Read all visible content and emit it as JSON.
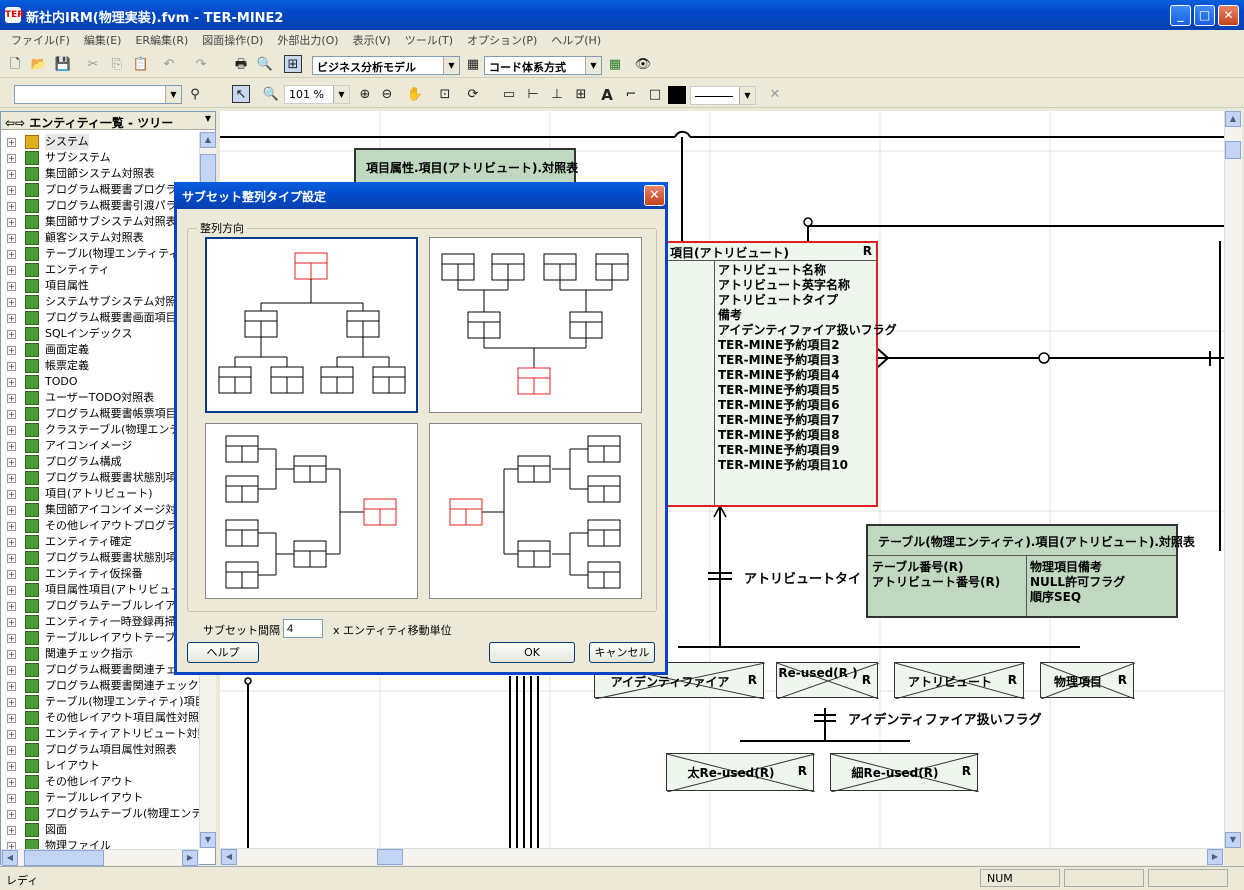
{
  "window": {
    "title": "新社内IRM(物理実装).fvm - TER-MINE2",
    "icon_text": "TER"
  },
  "menu": [
    "ファイル(F)",
    "編集(E)",
    "ER編集(R)",
    "図面操作(D)",
    "外部出力(O)",
    "表示(V)",
    "ツール(T)",
    "オプション(P)",
    "ヘルプ(H)"
  ],
  "toolbar": {
    "model_select": "ビジネス分析モデル",
    "code_select": "コード体系方式",
    "zoom": "101 %"
  },
  "left_panel": {
    "title": "エンティティ一覧 - ツリー",
    "items": [
      "システム",
      "サブシステム",
      "集団節システム対照表",
      "プログラム概要書プログラム",
      "プログラム概要書引渡パラメ",
      "集団節サブシステム対照表",
      "顧客システム対照表",
      "テーブル(物理エンティティ)",
      "エンティティ",
      "項目属性",
      "システムサブシステム対照表",
      "プログラム概要書画面項目",
      "SQLインデックス",
      "画面定義",
      "帳票定義",
      "TODO",
      "ユーザーTODO対照表",
      "プログラム概要書帳票項目",
      "クラステーブル(物理エンティ",
      "アイコンイメージ",
      "プログラム構成",
      "プログラム概要書状態別項",
      "項目(アトリビュート)",
      "集団節アイコンイメージ対照",
      "その他レイアウトプログラム対",
      "エンティティ確定",
      "プログラム概要書状態別項",
      "エンティティ仮採番",
      "項目属性項目(アトリビュー",
      "プログラムテーブルレイアウト",
      "エンティティ一時登録再掃",
      "テーブルレイアウトテーブル(",
      "関連チェック指示",
      "プログラム概要書関連チェッ",
      "プログラム概要書関連チェック指",
      "テーブル(物理エンティティ)項目(",
      "その他レイアウト項目属性対照表",
      "エンティティアトリビュート対照表",
      "プログラム項目属性対照表",
      "レイアウト",
      "その他レイアウト",
      "テーブルレイアウト",
      "プログラムテーブル(物理エンティ",
      "図面",
      "物理ファイル"
    ]
  },
  "diagram": {
    "entity_attr_map": {
      "title": "項目属性.項目(アトリビュート).対照表"
    },
    "entity_item": {
      "title": "項目(アトリビュート)",
      "tag": "R",
      "attributes": [
        "アトリビュート名称",
        "アトリビュート英字名称",
        "アトリビュートタイプ",
        "備考",
        "アイデンティファイア扱いフラグ",
        "TER-MINE予約項目2",
        "TER-MINE予約項目3",
        "TER-MINE予約項目4",
        "TER-MINE予約項目5",
        "TER-MINE予約項目6",
        "TER-MINE予約項目7",
        "TER-MINE予約項目8",
        "TER-MINE予約項目9",
        "TER-MINE予約項目10"
      ]
    },
    "entity_table_map": {
      "title": "テーブル(物理エンティティ).項目(アトリビュート).対照表",
      "keys": [
        "テーブル番号(R)",
        "アトリビュート番号(R)"
      ],
      "attrs": [
        "物理項目備考",
        "NULL許可フラグ",
        "順序SEQ"
      ]
    },
    "label_attr_type": "アトリビュートタイ",
    "label_id_flag": "アイデンティファイア扱いフラグ",
    "subtypes": [
      {
        "label": "アイデンティファイア",
        "tag": "R"
      },
      {
        "label": "Re-used(R )",
        "tag": "R"
      },
      {
        "label": "アトリビュート",
        "tag": "R"
      },
      {
        "label": "物理項目",
        "tag": "R"
      }
    ],
    "subtypes2": [
      {
        "label": "太Re-used(R)",
        "tag": "R"
      },
      {
        "label": "細Re-used(R)",
        "tag": "R"
      }
    ]
  },
  "dialog": {
    "title": "サブセット整列タイプ設定",
    "group_label": "整列方向",
    "spacing_label": "サブセット間隔",
    "spacing_value": "4",
    "spacing_unit": "x エンティティ移動単位",
    "help_label": "ヘルプ",
    "ok_label": "OK",
    "cancel_label": "キャンセル",
    "selected_option": 1
  },
  "status": {
    "text": "レディ",
    "num": "NUM"
  },
  "colors": {
    "accent": "#0a5fdc",
    "entity_fill": "#eef6ee",
    "entity_header": "#c0d8c0",
    "selected_border": "#e02020"
  }
}
